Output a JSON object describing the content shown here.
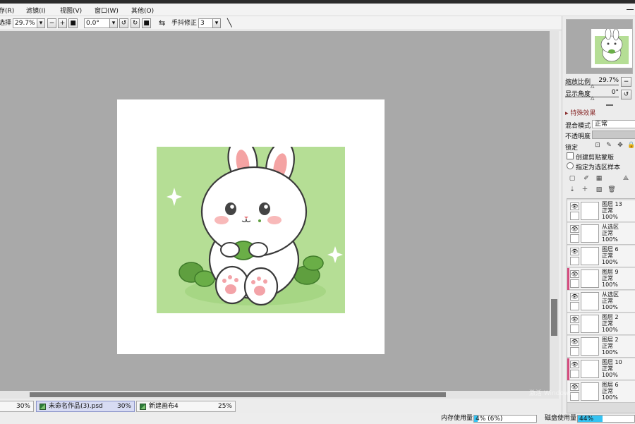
{
  "menu": {
    "items": [
      "存(R)",
      "滤镜(I)",
      "视图(V)",
      "窗口(W)",
      "其他(O)"
    ]
  },
  "toolbar": {
    "select_label": "选择",
    "zoom_value": "29.7%",
    "angle_value": "0.0°",
    "stabilizer_label": "手抖修正",
    "stabilizer_value": "3"
  },
  "navigator": {
    "zoom_label": "缩放比例",
    "zoom_value": "29.7%",
    "angle_label": "显示角度",
    "angle_value": "0°"
  },
  "layer_panel": {
    "effects_label": "特殊效果",
    "blend_mode_label": "混合模式",
    "blend_mode_value": "正常",
    "opacity_label": "不透明度",
    "lock_label": "锁定",
    "clip_label": "创建剪贴蒙版",
    "select_source_label": "指定为选区样本"
  },
  "layers": [
    {
      "name": "图层 13",
      "mode": "正常",
      "opacity": "100%",
      "marked": false
    },
    {
      "name": "从选区",
      "mode": "正常",
      "opacity": "100%",
      "marked": false
    },
    {
      "name": "图层 6",
      "mode": "正常",
      "opacity": "100%",
      "marked": false
    },
    {
      "name": "图层 9",
      "mode": "正常",
      "opacity": "100%",
      "marked": true
    },
    {
      "name": "从选区",
      "mode": "正常",
      "opacity": "100%",
      "marked": false
    },
    {
      "name": "图层 2",
      "mode": "正常",
      "opacity": "100%",
      "marked": false
    },
    {
      "name": "图层 2",
      "mode": "正常",
      "opacity": "100%",
      "marked": false
    },
    {
      "name": "图层 10",
      "mode": "正常",
      "opacity": "100%",
      "marked": true
    },
    {
      "name": "图层 6",
      "mode": "正常",
      "opacity": "100%",
      "marked": false
    }
  ],
  "tabs": [
    {
      "name": "",
      "zoom": "30%"
    },
    {
      "name": "未命名作品(3).psd",
      "zoom": "30%"
    },
    {
      "name": "新建画布4",
      "zoom": "25%"
    }
  ],
  "status": {
    "memory_label": "内存使用量",
    "memory_value": "4% (6%)",
    "memory_fill": 0.06,
    "disk_label": "磁盘使用量",
    "disk_value": "44%",
    "disk_fill": 0.44
  },
  "colors": {
    "canvas_bg": "#a9a9a9",
    "art_green": "#b5de95",
    "leaf_green": "#5f9f3f",
    "accent_pink": "#d54b7e",
    "meter_blue": "#35c3f2"
  }
}
